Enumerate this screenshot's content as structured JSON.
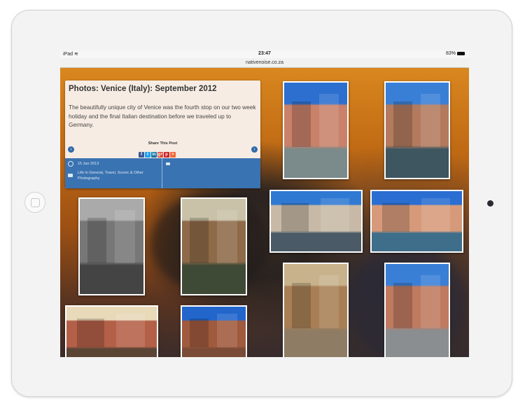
{
  "status": {
    "device": "iPad",
    "time": "23:47",
    "battery": "83%"
  },
  "browser": {
    "url": "nativenoise.co.za"
  },
  "post": {
    "title": "Photos: Venice (Italy): September 2012",
    "excerpt": "The beautifully unique city of Venice was the fourth stop on our two week holiday and the final Italian destination before we traveled up to Germany.",
    "share_label": "Share This Post",
    "share_icons": [
      {
        "name": "facebook",
        "glyph": "f",
        "color": "#3b5998"
      },
      {
        "name": "twitter",
        "glyph": "t",
        "color": "#1da1f2"
      },
      {
        "name": "linkedin",
        "glyph": "in",
        "color": "#0e76a8"
      },
      {
        "name": "googleplus",
        "glyph": "g+",
        "color": "#dd4b39"
      },
      {
        "name": "pinterest",
        "glyph": "p",
        "color": "#cb2027"
      },
      {
        "name": "more",
        "glyph": "+",
        "color": "#f26b3a"
      }
    ],
    "date": "15 Jan 2013",
    "categories": "Life in General, Travel, Scenic & Other Photography"
  },
  "photos": [
    {
      "name": "photo-canal-dock",
      "sky": "#2c6fcf",
      "bldg": "#c9816a",
      "ground": "#7b8a8a"
    },
    {
      "name": "photo-bridge-gondola",
      "sky": "#3a7fd6",
      "bldg": "#b37a5e",
      "ground": "#3d5660"
    },
    {
      "name": "photo-bw-canal",
      "sky": "#aaaaaa",
      "bldg": "#777777",
      "ground": "#444444"
    },
    {
      "name": "photo-arch-boat",
      "sky": "#c9c2a8",
      "bldg": "#8e6a49",
      "ground": "#3e4a36"
    },
    {
      "name": "photo-flower-wall",
      "sky": "#2f79d3",
      "bldg": "#c7b9a6",
      "ground": "#4a5a66"
    },
    {
      "name": "photo-grand-canal",
      "sky": "#2a6ed2",
      "bldg": "#d69a7a",
      "ground": "#3e6e8a"
    },
    {
      "name": "photo-alley-well",
      "sky": "#c8b28c",
      "bldg": "#a87f55",
      "ground": "#8e7c64"
    },
    {
      "name": "photo-bridge-steps",
      "sky": "#3a7fd6",
      "bldg": "#bf7a60",
      "ground": "#8a8e90"
    },
    {
      "name": "photo-ornate-bridge",
      "sky": "#e8d9b9",
      "bldg": "#b46048",
      "ground": "#5a4535"
    },
    {
      "name": "photo-clock-tower",
      "sky": "#2266cc",
      "bldg": "#a05a3e",
      "ground": "#7a4b36"
    }
  ]
}
